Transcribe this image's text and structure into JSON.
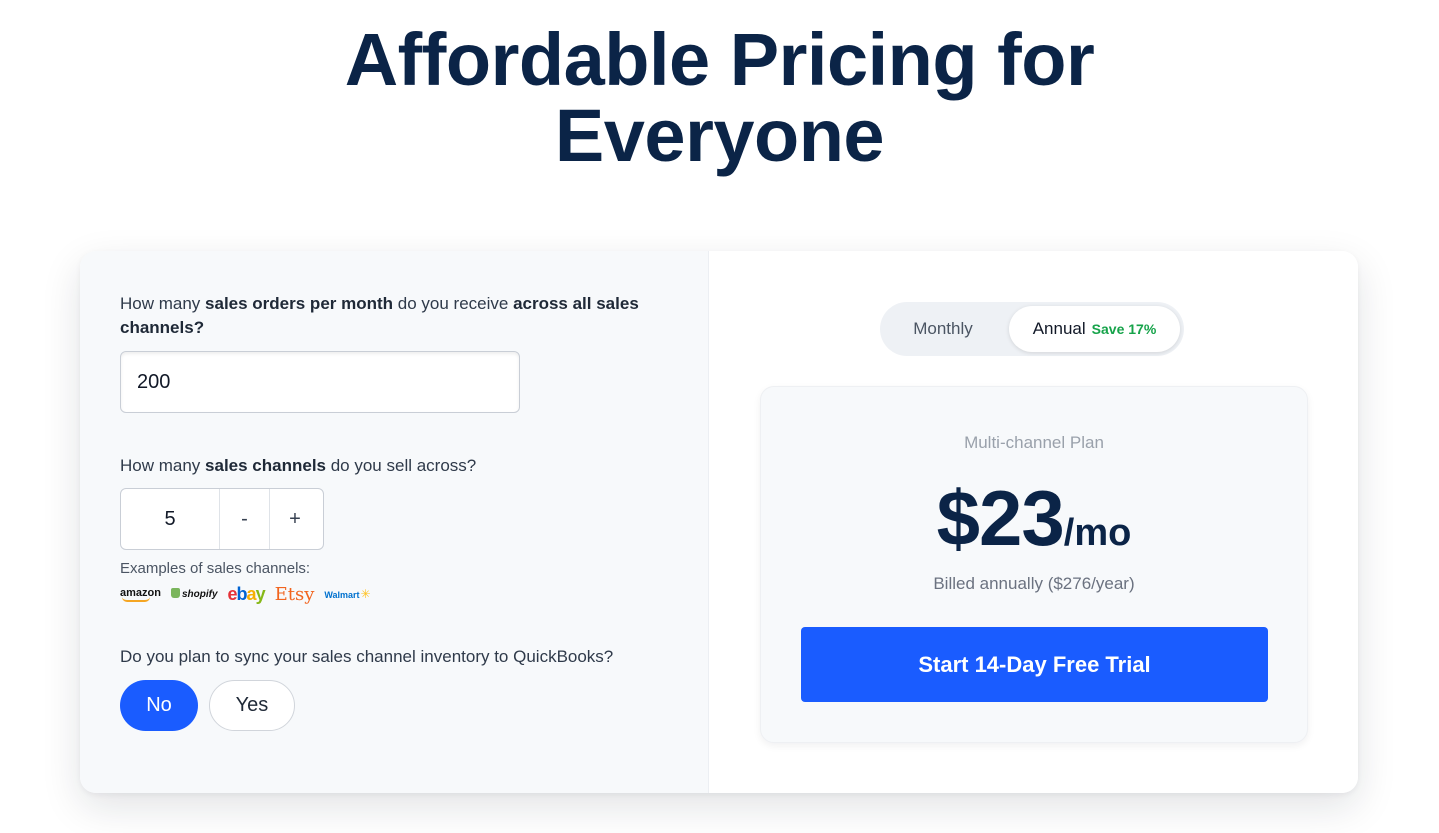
{
  "page": {
    "title_line1": "Affordable Pricing for",
    "title_line2": "Everyone"
  },
  "form": {
    "orders_question": {
      "pre": "How many ",
      "bold1": "sales orders per month",
      "mid": " do you receive ",
      "bold2": "across all sales channels?"
    },
    "orders_value": "200",
    "channels_question": {
      "pre": "How many ",
      "bold": "sales channels",
      "post": " do you sell across?"
    },
    "channels_value": "5",
    "decrement_label": "-",
    "increment_label": "+",
    "examples_label": "Examples of sales channels:",
    "logos": {
      "amazon": "amazon",
      "shopify": "shopify",
      "ebay": [
        "e",
        "b",
        "a",
        "y"
      ],
      "etsy": "Etsy",
      "walmart": "Walmart",
      "walmart_spark": "✳"
    },
    "sync_question": "Do you plan to sync your sales channel inventory to QuickBooks?",
    "sync_no": "No",
    "sync_yes": "Yes",
    "sync_selected": "No"
  },
  "billing": {
    "monthly_label": "Monthly",
    "annual_label": "Annual",
    "save_badge": "Save 17%",
    "selected": "Annual"
  },
  "plan": {
    "name": "Multi-channel Plan",
    "price": "$23",
    "period": "/mo",
    "billed_note": "Billed annually ($276/year)",
    "cta_label": "Start 14-Day Free Trial"
  },
  "colors": {
    "primary": "#1a5cff",
    "heading": "#0b2447",
    "save_green": "#16a34a"
  }
}
